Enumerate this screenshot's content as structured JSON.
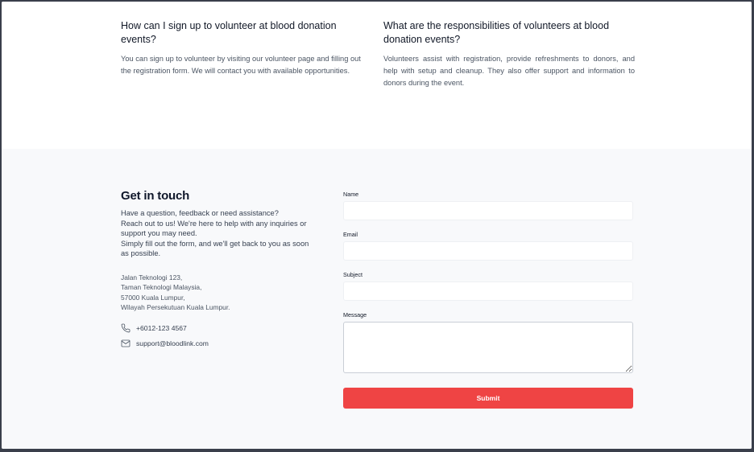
{
  "faq": {
    "items": [
      {
        "question": "How can I sign up to volunteer at blood donation events?",
        "answer": "You can sign up to volunteer by visiting our volunteer page and filling out the registration form. We will contact you with available opportunities."
      },
      {
        "question": "What are the responsibilities of volunteers at blood donation events?",
        "answer": "Volunteers assist with registration, provide refreshments to donors, and help with setup and cleanup. They also offer support and information to donors during the event."
      }
    ]
  },
  "contact": {
    "title": "Get in touch",
    "intro": [
      "Have a question, feedback or need assistance?",
      "Reach out to us! We're here to help with any inquiries or support you may need.",
      "Simply fill out the form, and we'll get back to you as soon as possible."
    ],
    "address": [
      "Jalan Teknologi 123,",
      "Taman Teknologi Malaysia,",
      "57000 Kuala Lumpur,",
      "Wilayah Persekutuan Kuala Lumpur."
    ],
    "phone": {
      "icon": "phone-icon",
      "value": "+6012-123 4567"
    },
    "email": {
      "icon": "mail-icon",
      "value": "support@bloodlink.com"
    }
  },
  "form": {
    "name_label": "Name",
    "name_value": "",
    "email_label": "Email",
    "email_value": "",
    "subject_label": "Subject",
    "subject_value": "",
    "message_label": "Message",
    "message_value": "",
    "submit_label": "Submit"
  },
  "colors": {
    "accent": "#ef4444",
    "contact_background": "#f8f9fb"
  }
}
